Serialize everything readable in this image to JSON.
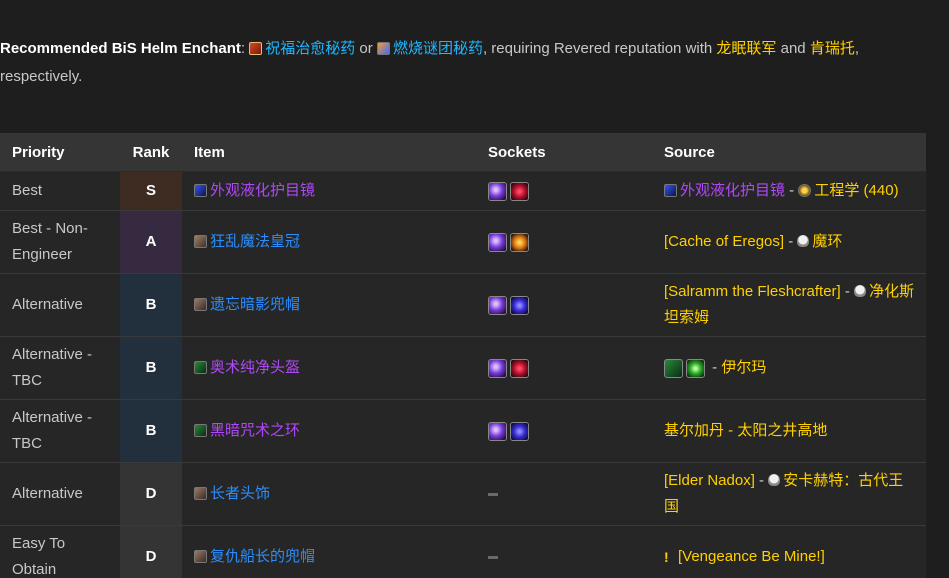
{
  "intro": {
    "label": "Recommended BiS Helm Enchant",
    "colon": ":",
    "enchant1": "祝福治愈秘药",
    "or": " or ",
    "enchant2": "燃烧谜团秘药",
    "requiring": ", requiring Revered reputation with ",
    "faction1": "龙眠联军",
    "and": " and ",
    "faction2": "肯瑞托",
    "respectively": ", respectively."
  },
  "table": {
    "headers": [
      "Priority",
      "Rank",
      "Item",
      "Sockets",
      "Source"
    ],
    "rows": [
      {
        "priority": "Best",
        "rank": "S",
        "item": "外观液化护目镜",
        "item_quality": "purple",
        "item_icon": "goggles-icon",
        "sockets": [
          "meta",
          "red"
        ],
        "source_item": "外观液化护目镜",
        "source_sep": " - ",
        "source_prof": "工程学",
        "source_skill": " (440)"
      },
      {
        "priority": "Best - Non-Engineer",
        "rank": "A",
        "item": "狂乱魔法皇冠",
        "item_quality": "blue",
        "item_icon": "crown-icon",
        "sockets": [
          "meta",
          "orange"
        ],
        "source_text": "[Cache of Eregos]",
        "source_sep": " - ",
        "source_boss": "魔环"
      },
      {
        "priority": "Alternative",
        "rank": "B",
        "item": "遗忘暗影兜帽",
        "item_quality": "blue",
        "item_icon": "hood-icon",
        "sockets": [
          "meta",
          "blue"
        ],
        "source_text": "[Salramm the Fleshcrafter]",
        "source_sep": " - ",
        "source_boss": "净化斯坦索姆"
      },
      {
        "priority": "Alternative - TBC",
        "rank": "B",
        "item": "奥术纯净头盔",
        "item_quality": "purple",
        "item_icon": "helm-icon",
        "sockets": [
          "meta",
          "red"
        ],
        "source_icons": [
          "helm-icon",
          "ring-icon"
        ],
        "source_sep": " - ",
        "source_boss": "伊尔玛"
      },
      {
        "priority": "Alternative - TBC",
        "rank": "B",
        "item": "黑暗咒术之环",
        "item_quality": "purple",
        "item_icon": "helm-icon",
        "sockets": [
          "meta",
          "blue"
        ],
        "source_text": "基尔加丹 - 太阳之井高地"
      },
      {
        "priority": "Alternative",
        "rank": "D",
        "item": "长者头饰",
        "item_quality": "blue",
        "item_icon": "hood-icon",
        "sockets": [],
        "source_text": "[Elder Nadox]",
        "source_sep": " - ",
        "source_boss": "安卡赫特：古代王国"
      },
      {
        "priority": "Easy To Obtain",
        "rank": "D",
        "item": "复仇船长的兜帽",
        "item_quality": "blue",
        "item_icon": "hood-icon",
        "sockets": [],
        "source_quest": "[Vengeance Be Mine!]"
      }
    ]
  },
  "colors": {
    "gold": "#ffd000",
    "link_blue": "#1fb8ff",
    "epic_purple": "#b048f8",
    "rare_blue": "#2a8eff",
    "rank_S_bg": "#3e2c22",
    "rank_A_bg": "#352a3f",
    "rank_B_bg": "#22303e",
    "rank_D_bg": "#343434"
  }
}
